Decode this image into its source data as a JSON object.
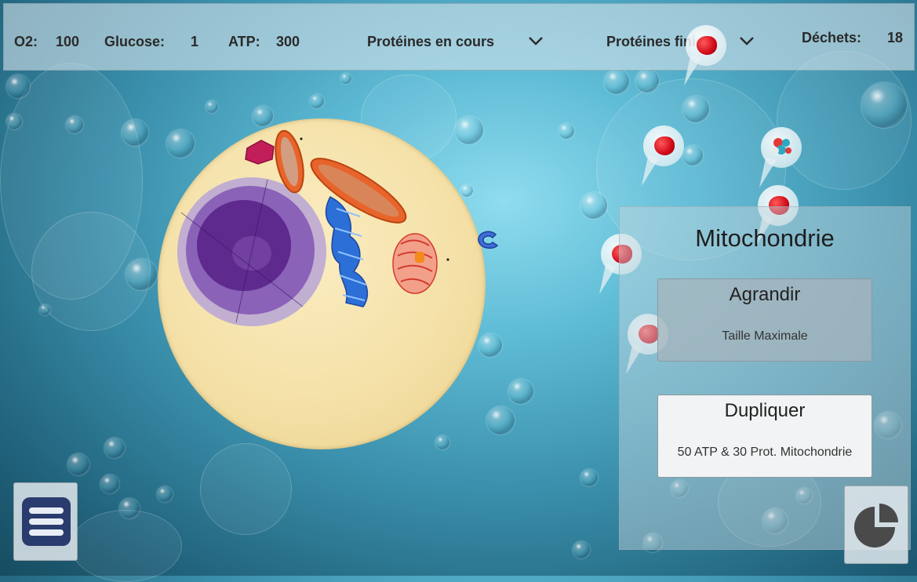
{
  "stats": {
    "o2_label": "O2:",
    "o2_value": "100",
    "glucose_label": "Glucose:",
    "glucose_value": "1",
    "atp_label": "ATP:",
    "atp_value": "300",
    "waste_label": "Déchets:",
    "waste_value": "18"
  },
  "dropdowns": {
    "in_progress": "Protéines en cours",
    "finished": "Protéines finies"
  },
  "panel": {
    "title": "Mitochondrie",
    "enlarge_label": "Agrandir",
    "enlarge_note": "Taille Maximale",
    "duplicate_label": "Dupliquer",
    "duplicate_cost": "50 ATP & 30 Prot. Mitochondrie"
  },
  "icons": {
    "menu": "menu-icon",
    "stats": "pie-chart-icon",
    "chevron": "chevron-down-icon"
  },
  "colors": {
    "cell": "#f4e0a6",
    "nucleus": "#6a3a9c",
    "mitochondria": "#e8642a",
    "protein": "#d10a18",
    "menu_button": "#2a3c6e"
  }
}
